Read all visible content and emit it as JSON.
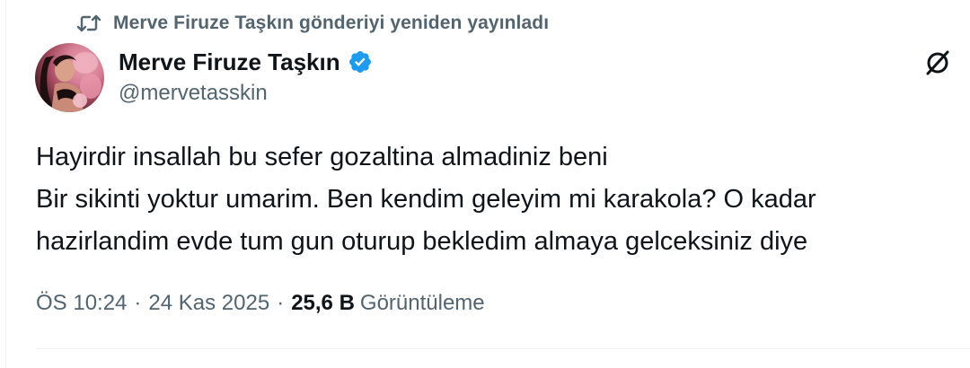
{
  "repost": {
    "icon": "repost-icon",
    "text": "Merve Firuze Taşkın gönderiyi yeniden yayınladı"
  },
  "author": {
    "display_name": "Merve Firuze Taşkın",
    "handle": "@mervetasskin",
    "verified": true,
    "avatar_icon": "profile-photo"
  },
  "post": {
    "lines": [
      "Hayirdir insallah bu sefer gozaltina almadiniz beni",
      "Bir sikinti yoktur umarim. Ben kendim geleyim mi karakola? O kadar",
      "hazirlandim evde tum gun oturup bekledim almaya gelceksiniz diye"
    ]
  },
  "meta": {
    "time": "ÖS 10:24",
    "separator": "·",
    "date": "24 Kas 2025",
    "views": "25,6 B",
    "views_label": "Görüntüleme"
  },
  "actions": {
    "grok_icon": "grok-icon"
  },
  "colors": {
    "text_primary": "#0f1419",
    "text_secondary": "#536471",
    "verified_blue": "#1d9bf0",
    "border": "#eff3f4"
  }
}
